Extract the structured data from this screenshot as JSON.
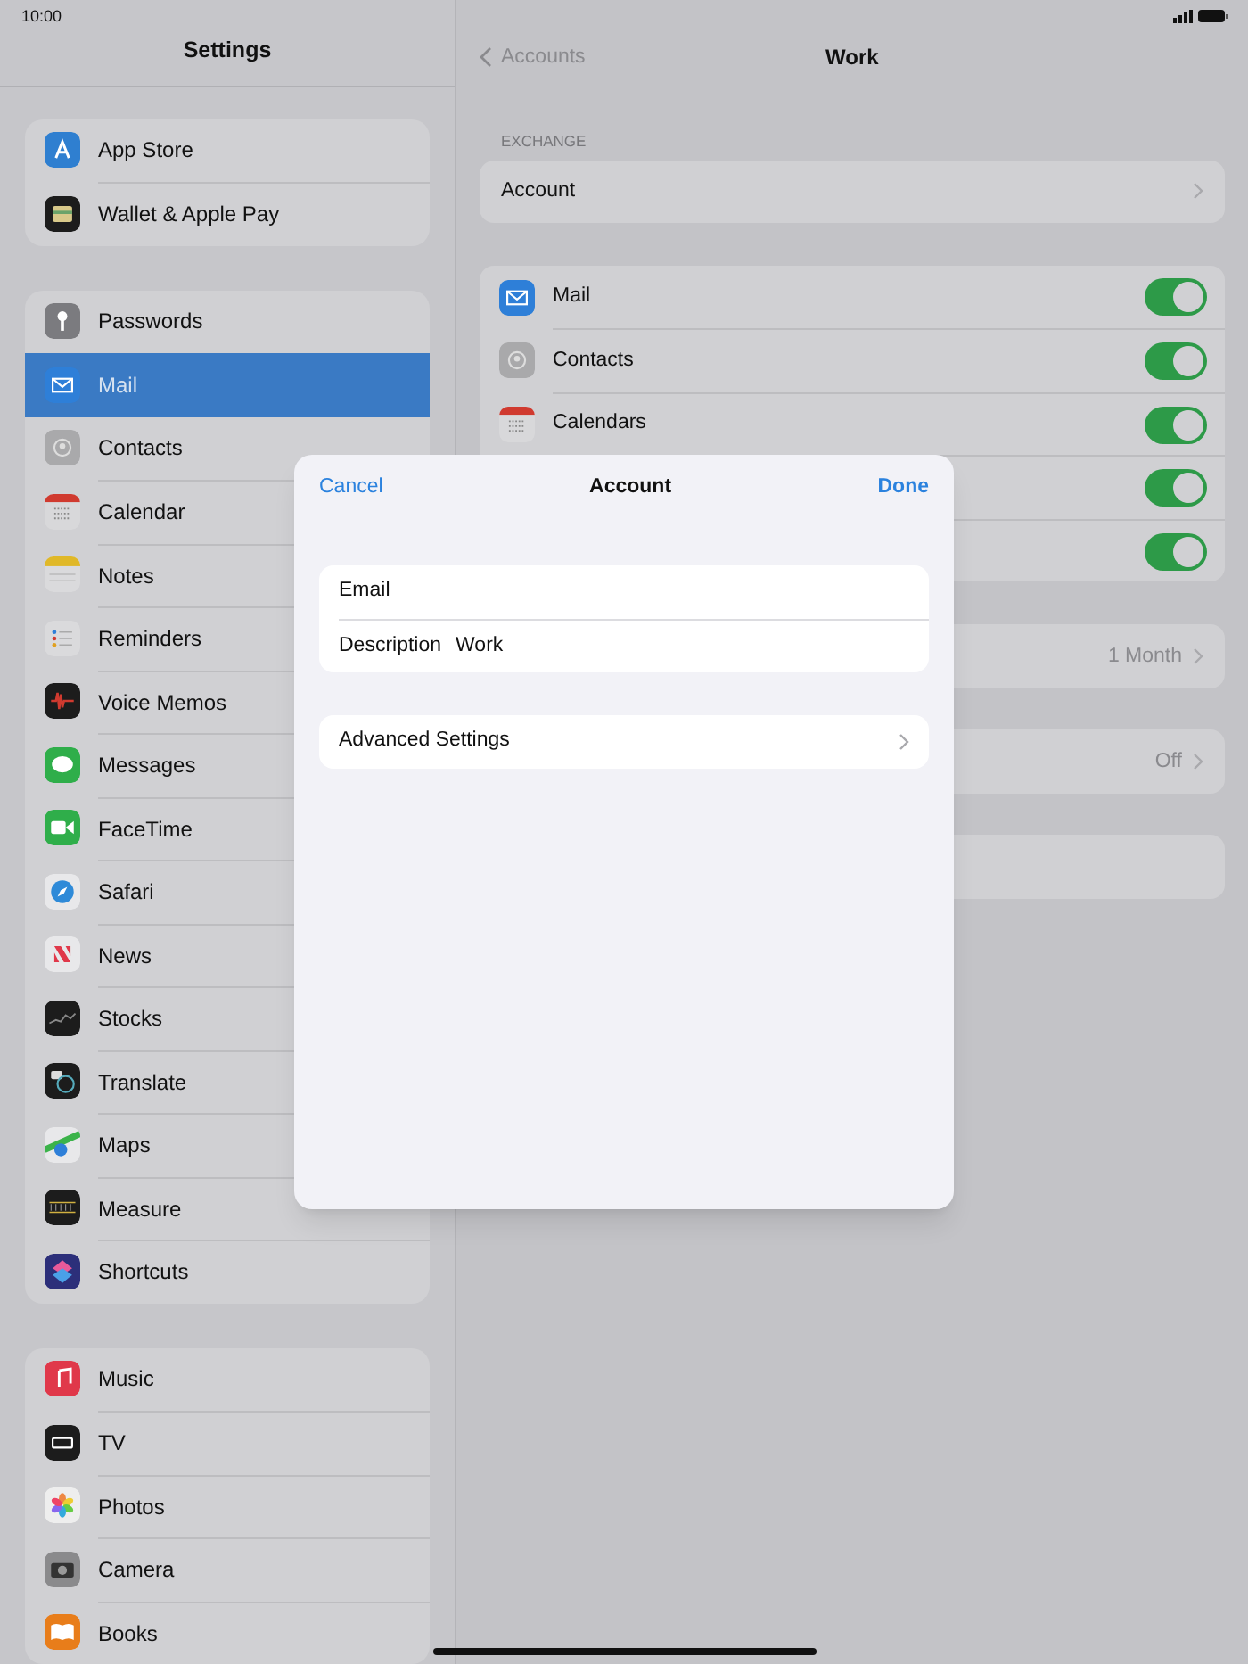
{
  "status_bar": {
    "time": "10:00"
  },
  "sidebar": {
    "title": "Settings",
    "groups": [
      {
        "items": [
          {
            "label": "App Store",
            "selected": false
          },
          {
            "label": "Wallet & Apple Pay",
            "selected": false
          }
        ]
      },
      {
        "items": [
          {
            "label": "Passwords",
            "selected": false
          },
          {
            "label": "Mail",
            "selected": true
          },
          {
            "label": "Contacts",
            "selected": false
          },
          {
            "label": "Calendar",
            "selected": false
          },
          {
            "label": "Notes",
            "selected": false
          },
          {
            "label": "Reminders",
            "selected": false
          },
          {
            "label": "Voice Memos",
            "selected": false
          },
          {
            "label": "Messages",
            "selected": false
          },
          {
            "label": "FaceTime",
            "selected": false
          },
          {
            "label": "Safari",
            "selected": false
          },
          {
            "label": "News",
            "selected": false
          },
          {
            "label": "Stocks",
            "selected": false
          },
          {
            "label": "Translate",
            "selected": false
          },
          {
            "label": "Maps",
            "selected": false
          },
          {
            "label": "Measure",
            "selected": false
          },
          {
            "label": "Shortcuts",
            "selected": false
          }
        ]
      },
      {
        "items": [
          {
            "label": "Music",
            "selected": false
          },
          {
            "label": "TV",
            "selected": false
          },
          {
            "label": "Photos",
            "selected": false
          },
          {
            "label": "Camera",
            "selected": false
          },
          {
            "label": "Books",
            "selected": false
          }
        ]
      }
    ]
  },
  "detail": {
    "back": "Accounts",
    "title": "Work",
    "section_header": "EXCHANGE",
    "account_row": "Account",
    "services": [
      {
        "label": "Mail",
        "on": true
      },
      {
        "label": "Contacts",
        "on": true
      },
      {
        "label": "Calendars",
        "on": true
      },
      {
        "on": true
      },
      {
        "on": true
      }
    ],
    "rows": [
      {
        "kind": "value",
        "value": "1 Month"
      },
      {
        "kind": "value",
        "value": "Off"
      },
      {
        "kind": "blank"
      }
    ]
  },
  "modal": {
    "cancel": "Cancel",
    "title": "Account",
    "done": "Done",
    "fields": [
      {
        "label": "Email"
      },
      {
        "label": "Description",
        "value": "Work"
      }
    ],
    "advanced": "Advanced Settings"
  }
}
